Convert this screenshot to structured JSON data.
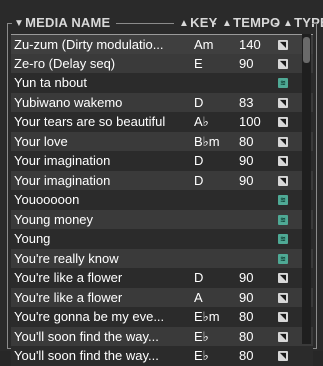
{
  "header": {
    "name_label": "MEDIA NAME",
    "key_label": "KEY",
    "tempo_label": "TEMPO",
    "type_label": "TYPE",
    "sort_glyph": "▼",
    "col_glyph": "▲",
    "sep": "-"
  },
  "colors": {
    "background": "#2a2a2a",
    "row_alt": "#3a3a3a",
    "frame": "#8a8a8a",
    "midi_badge": "#d8d8d8",
    "audio_badge": "#4fa995"
  },
  "rows": [
    {
      "name": "Zu-zum (Dirty modulatio...",
      "key": "Am",
      "tempo": "140",
      "type": "midi",
      "type_glyph": "◥"
    },
    {
      "name": "Ze-ro (Delay seq)",
      "key": "E",
      "tempo": "90",
      "type": "midi",
      "type_glyph": "◥"
    },
    {
      "name": "Yun ta nbout",
      "key": "",
      "tempo": "",
      "type": "audio",
      "type_glyph": "≋"
    },
    {
      "name": "Yubiwano wakemo",
      "key": "D",
      "tempo": "83",
      "type": "midi",
      "type_glyph": "◥"
    },
    {
      "name": "Your tears are so beautiful",
      "key": "A♭",
      "tempo": "100",
      "type": "midi",
      "type_glyph": "◥"
    },
    {
      "name": "Your love",
      "key": "B♭m",
      "tempo": "80",
      "type": "midi",
      "type_glyph": "◥"
    },
    {
      "name": "Your imagination",
      "key": "D",
      "tempo": "90",
      "type": "midi",
      "type_glyph": "◥"
    },
    {
      "name": "Your imagination",
      "key": "D",
      "tempo": "90",
      "type": "midi",
      "type_glyph": "◥"
    },
    {
      "name": "Youooooon",
      "key": "",
      "tempo": "",
      "type": "audio",
      "type_glyph": "≋"
    },
    {
      "name": "Young money",
      "key": "",
      "tempo": "",
      "type": "audio",
      "type_glyph": "≋"
    },
    {
      "name": "Young",
      "key": "",
      "tempo": "",
      "type": "audio",
      "type_glyph": "≋"
    },
    {
      "name": "You're really know",
      "key": "",
      "tempo": "",
      "type": "audio",
      "type_glyph": "≋"
    },
    {
      "name": "You're like a flower",
      "key": "D",
      "tempo": "90",
      "type": "midi",
      "type_glyph": "◥"
    },
    {
      "name": "You're like a flower",
      "key": "A",
      "tempo": "90",
      "type": "midi",
      "type_glyph": "◥"
    },
    {
      "name": "You're gonna be my eve...",
      "key": "E♭m",
      "tempo": "80",
      "type": "midi",
      "type_glyph": "◥"
    },
    {
      "name": "You'll soon find the way...",
      "key": "E♭",
      "tempo": "80",
      "type": "midi",
      "type_glyph": "◥"
    },
    {
      "name": "You'll soon find the way...",
      "key": "E♭",
      "tempo": "80",
      "type": "midi",
      "type_glyph": "◥"
    }
  ]
}
